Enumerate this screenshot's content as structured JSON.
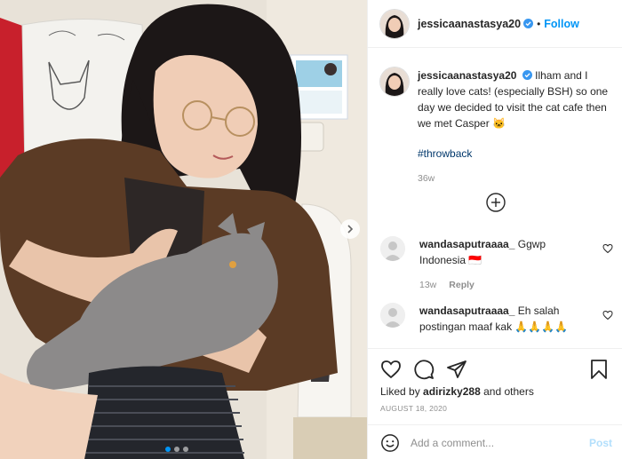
{
  "post": {
    "author": "jessicaanastasya20",
    "follow_label": "Follow",
    "separator": "•",
    "caption": "Ilham and I really love cats! (especially BSH) so one day we decided to visit the cat cafe then we met Casper 🐱",
    "hashtag": "#throwback",
    "caption_time": "36w",
    "verified_icon": "verified-badge-icon"
  },
  "comments": [
    {
      "username": "wandasaputraaaa_",
      "text": "Ggwp Indonesia 🇮🇩",
      "time": "13w",
      "reply_label": "Reply"
    },
    {
      "username": "wandasaputraaaa_",
      "text": "Eh salah postingan maaf kak 🙏🙏🙏🙏",
      "time": "",
      "reply_label": ""
    }
  ],
  "actions": {
    "icons": [
      "heart-icon",
      "comment-icon",
      "share-icon",
      "bookmark-icon"
    ],
    "liked_by_prefix": "Liked by",
    "liked_by_user": "adirizky288",
    "liked_by_suffix": "and others",
    "date": "AUGUST 18, 2020"
  },
  "composer": {
    "placeholder": "Add a comment...",
    "post_label": "Post",
    "emoji_icon": "emoji-icon"
  },
  "carousel": {
    "slide_count": 3,
    "active_slide": 1
  },
  "colors": {
    "accent": "#0095f6",
    "text": "#262626",
    "muted": "#8e8e8e",
    "hashtag": "#00376b",
    "post_disabled": "#b2dffc"
  }
}
